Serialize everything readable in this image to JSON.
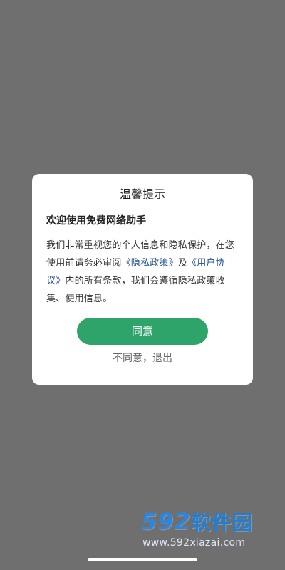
{
  "dialog": {
    "title": "温馨提示",
    "subtitle": "欢迎使用免费网络助手",
    "body_parts": {
      "part1": "我们非常重视您的个人信息和隐私保护，在您使用前请务必审阅",
      "privacy_link": "《隐私政策》",
      "and": "及",
      "user_link": "《用户协议》",
      "part2": "内的所有条款，我们会遵循隐私政策收集、使用信息。"
    },
    "agree_label": "同意",
    "disagree_label": "不同意，退出"
  },
  "watermark": {
    "main_number": "592",
    "main_text": "软件园",
    "url": "www.592xiazai.com"
  },
  "colors": {
    "overlay": "#6f6f6f",
    "dialog_bg": "#ffffff",
    "accent": "#2ea36a",
    "link": "#1f4f8f"
  }
}
